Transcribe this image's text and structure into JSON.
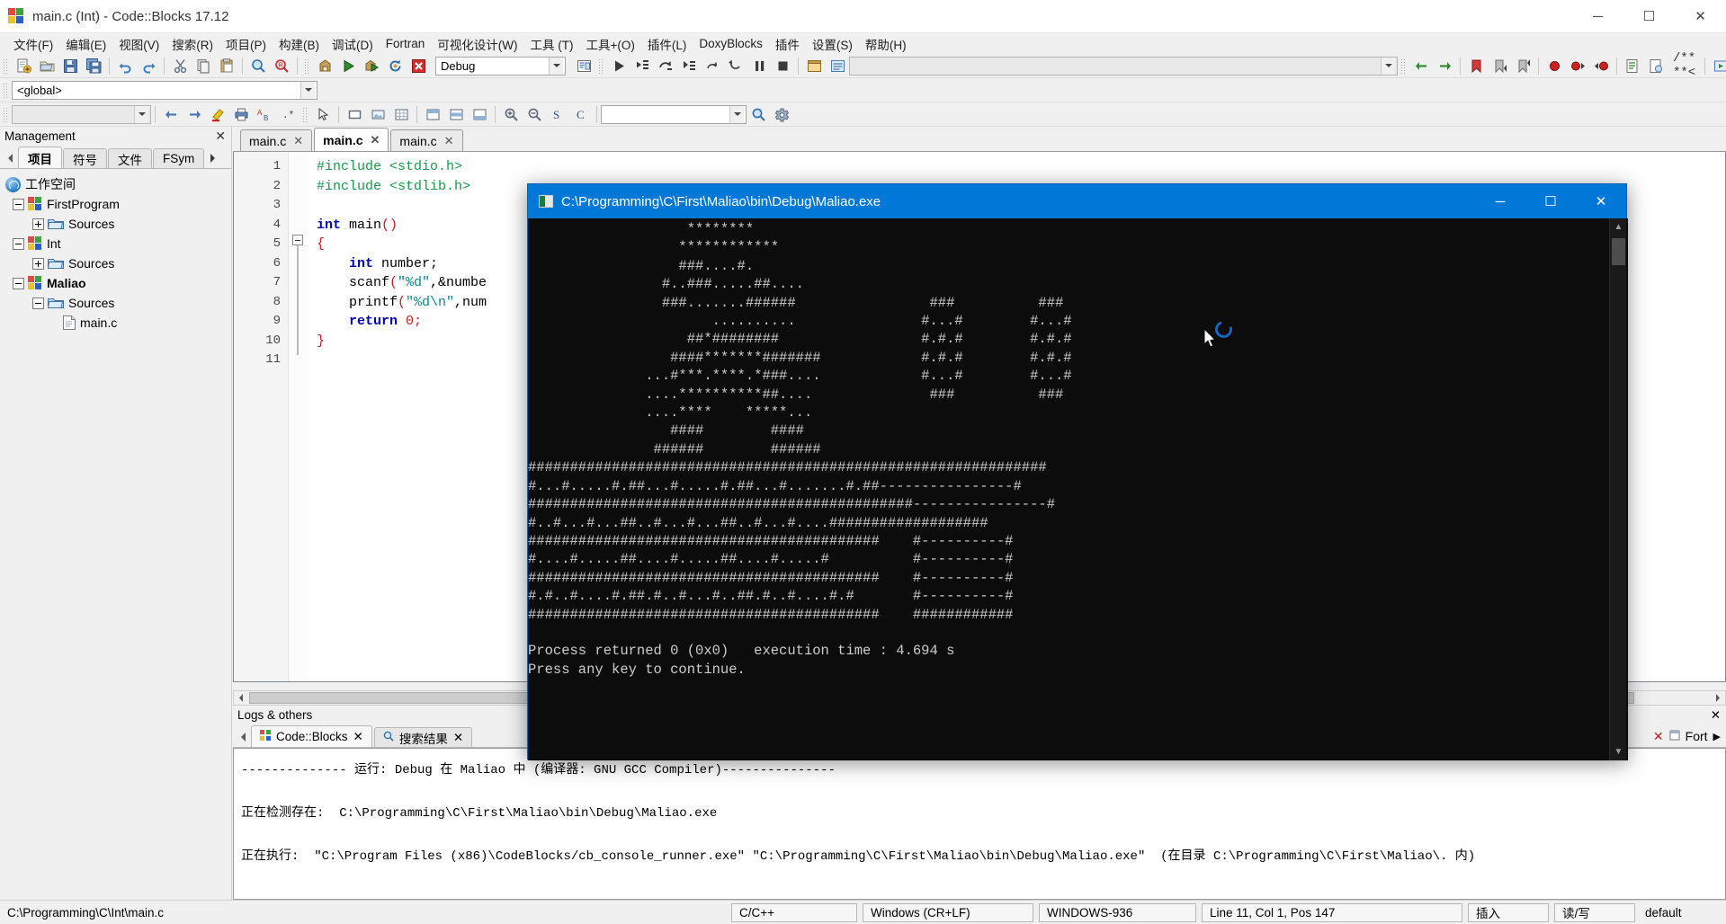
{
  "window": {
    "title": "main.c (Int) - Code::Blocks 17.12",
    "minimize": "─",
    "maximize": "☐",
    "close": "✕"
  },
  "menu": {
    "items": [
      {
        "label": "文件(F)"
      },
      {
        "label": "编辑(E)"
      },
      {
        "label": "视图(V)"
      },
      {
        "label": "搜索(R)"
      },
      {
        "label": "项目(P)"
      },
      {
        "label": "构建(B)"
      },
      {
        "label": "调试(D)"
      },
      {
        "label": "Fortran"
      },
      {
        "label": "可视化设计(W)"
      },
      {
        "label": "工具 (T)"
      },
      {
        "label": "工具+(O)"
      },
      {
        "label": "插件(L)"
      },
      {
        "label": "DoxyBlocks"
      },
      {
        "label": "插件"
      },
      {
        "label": "设置(S)"
      },
      {
        "label": "帮助(H)"
      }
    ]
  },
  "toolbar": {
    "build_target_value": "Debug",
    "scope_value": "<global>",
    "symbol_value": "",
    "search_value": "",
    "doxy_label": "/** **<",
    "icons_row1": [
      "new-file-icon",
      "open-file-icon",
      "save-icon",
      "save-all-icon",
      "undo-icon",
      "redo-icon",
      "cut-icon",
      "copy-icon",
      "paste-icon",
      "find-icon",
      "replace-icon",
      "build-icon",
      "run-icon",
      "build-and-run-icon",
      "rebuild-icon",
      "abort-icon",
      "build-target-select",
      "show-build-messages-icon",
      "debug-run-icon",
      "debug-step-into-icon",
      "debug-step-over-icon",
      "debug-step-out-icon",
      "debug-next-instruction-icon",
      "debug-step-instruction-icon",
      "debug-break-icon",
      "debug-stop-icon",
      "debugging-windows-icon",
      "various-info-icon"
    ],
    "icons_row3": [
      "back-icon",
      "forward-icon",
      "bookmark-toggle-icon",
      "bookmark-prev-icon",
      "bookmark-next-icon",
      "breakpoint-toggle-icon",
      "breakpoint-prev-icon",
      "breakpoint-next-icon",
      "comment-icon",
      "uncomment-icon",
      "doxy-comment-icon",
      "doxy-extract-icon",
      "doxy-config-icon",
      "doxy-run-icon",
      "align-left-icon",
      "center-icon",
      "align-right-icon"
    ],
    "icons_row2_left": [
      "scope-select"
    ],
    "icons_row2_right": [
      "prev-symbol-icon",
      "next-symbol-icon",
      "highlight-icon",
      "printer-icon",
      "translate-icon",
      "regex-icon",
      "select-pointer-icon",
      "rect-icon",
      "image-icon",
      "grid-icon",
      "layout-top-icon",
      "layout-mid-icon",
      "layout-bottom-icon",
      "zoom-in-icon",
      "zoom-out-icon",
      "s-icon",
      "c-icon",
      "search-field",
      "search-go-icon",
      "settings-icon"
    ]
  },
  "management": {
    "header": "Management",
    "close_icon": "✕",
    "tabs": [
      {
        "label": "项目",
        "active": true
      },
      {
        "label": "符号",
        "active": false
      },
      {
        "label": "文件",
        "active": false
      },
      {
        "label": "FSym",
        "active": false
      }
    ],
    "scroll_left_icon": "◀",
    "scroll_right_icon": "▶",
    "tree": [
      {
        "label": "工作空间",
        "depth": 0,
        "icon": "workspace-icon",
        "toggle": "none",
        "bold": false
      },
      {
        "label": "FirstProgram",
        "depth": 1,
        "icon": "project-icon",
        "toggle": "minus",
        "bold": false
      },
      {
        "label": "Sources",
        "depth": 2,
        "icon": "folder-icon",
        "toggle": "plus",
        "bold": false
      },
      {
        "label": "Int",
        "depth": 1,
        "icon": "project-icon",
        "toggle": "minus",
        "bold": false
      },
      {
        "label": "Sources",
        "depth": 2,
        "icon": "folder-icon",
        "toggle": "plus",
        "bold": false
      },
      {
        "label": "Maliao",
        "depth": 1,
        "icon": "project-icon",
        "toggle": "minus",
        "bold": true
      },
      {
        "label": "Sources",
        "depth": 2,
        "icon": "folder-icon",
        "toggle": "minus",
        "bold": false
      },
      {
        "label": "main.c",
        "depth": 3,
        "icon": "c-file-icon",
        "toggle": "none",
        "bold": false
      }
    ]
  },
  "editor": {
    "tabs": [
      {
        "label": "main.c",
        "active": false,
        "close": "✕"
      },
      {
        "label": "main.c",
        "active": true,
        "close": "✕"
      },
      {
        "label": "main.c",
        "active": false,
        "close": "✕"
      }
    ],
    "line_numbers": [
      "1",
      "2",
      "3",
      "4",
      "5",
      "6",
      "7",
      "8",
      "9",
      "10",
      "11"
    ],
    "lines": [
      [
        {
          "t": "#include <stdio.h>",
          "c": "k-pre"
        }
      ],
      [
        {
          "t": "#include <stdlib.h>",
          "c": "k-pre"
        }
      ],
      [
        {
          "t": "",
          "c": "k-id"
        }
      ],
      [
        {
          "t": "int",
          "c": "k-kw"
        },
        {
          "t": " main",
          "c": "k-id"
        },
        {
          "t": "()",
          "c": "k-pun"
        }
      ],
      [
        {
          "t": "{",
          "c": "k-pun"
        }
      ],
      [
        {
          "t": "    int",
          "c": "k-kw"
        },
        {
          "t": " number;",
          "c": "k-id"
        }
      ],
      [
        {
          "t": "    scanf",
          "c": "k-id"
        },
        {
          "t": "(",
          "c": "k-pun"
        },
        {
          "t": "\"%d\"",
          "c": "k-str"
        },
        {
          "t": ",&numbe",
          "c": "k-id"
        }
      ],
      [
        {
          "t": "    printf",
          "c": "k-id"
        },
        {
          "t": "(",
          "c": "k-pun"
        },
        {
          "t": "\"%d\\n\"",
          "c": "k-str"
        },
        {
          "t": ",num",
          "c": "k-id"
        }
      ],
      [
        {
          "t": "    return",
          "c": "k-kw"
        },
        {
          "t": " ",
          "c": "k-id"
        },
        {
          "t": "0",
          "c": "k-num"
        },
        {
          "t": ";",
          "c": "k-pun"
        }
      ],
      [
        {
          "t": "}",
          "c": "k-pun"
        }
      ],
      [
        {
          "t": "",
          "c": "k-id"
        }
      ]
    ]
  },
  "logs": {
    "header": "Logs & others",
    "close_icon": "✕",
    "scroll_left_icon": "◀",
    "scroll_right_icon": "▶",
    "tabs": [
      {
        "label": "Code::Blocks",
        "active": true,
        "icon": "codeblocks-icon",
        "close": "✕"
      },
      {
        "label": "搜索结果",
        "active": false,
        "icon": "search-icon",
        "close": "✕"
      }
    ],
    "right_close": "✕",
    "right_label": "Fort",
    "right_arrow": "▶",
    "body_lines": [
      "-------------- 运行: Debug 在 Maliao 中 (编译器: GNU GCC Compiler)---------------",
      "",
      "正在检测存在:  C:\\Programming\\C\\First\\Maliao\\bin\\Debug\\Maliao.exe",
      "",
      "正在执行:  \"C:\\Program Files (x86)\\CodeBlocks/cb_console_runner.exe\" \"C:\\Programming\\C\\First\\Maliao\\bin\\Debug\\Maliao.exe\"  (在目录 C:\\Programming\\C\\First\\Maliao\\. 内)"
    ]
  },
  "statusbar": {
    "file_path": "C:\\Programming\\C\\Int\\main.c",
    "language": "C/C++",
    "line_ending": "Windows (CR+LF)",
    "encoding": "WINDOWS-936",
    "caret": "Line 11, Col 1, Pos 147",
    "insert_mode": "插入",
    "readwrite": "读/写",
    "profile": "default"
  },
  "console": {
    "title": "C:\\Programming\\C\\First\\Maliao\\bin\\Debug\\Maliao.exe",
    "minimize": "─",
    "maximize": "☐",
    "close": "✕",
    "scroll_up": "▲",
    "scroll_down": "▼",
    "output": "                   ********\n                  ************\n                  ###....#.\n                #..###.....##....\n                ###.......######                ###          ###\n                                               #...#        #...#\n                      ..........                #.#.#        #.#.#\n                   ##*########                  #.#.#        #.#.#\n                 ####*******#######              #...#        #...#\n              ...#***.****.*###....               ###          ###\n              ....**********##....\n              ....****    *****...\n                 ####        ####\n               ######        ######\n##############################################################\n#...#.....#.##...#.....#.##...#.......#.##----------------#\n##############################################----------------#\n#..#...#...##..#...#...##..#...#....###################\n##########################################    #----------#\n#....#.....##....#.....##....#.....#          #----------#\n##########################################    #----------#\n#.#..#....#.##.#..#...#..##.#..#....#.#       #----------#\n##########################################    ############\n\nProcess returned 0 (0x0)   execution time : 4.694 s\nPress any key to continue.",
    "output_lines": [
      "                   ********",
      "                  ************",
      "                  ###....#.",
      "                #..###.....##....",
      "                ###.......######                ###          ###",
      "                      ..........               #...#        #...#",
      "                   ##*########                 #.#.#        #.#.#",
      "                 ####*******#######            #.#.#        #.#.#",
      "              ...#***.****.*###....            #...#        #...#",
      "              ....**********##....              ###          ###",
      "              ....****    *****...",
      "                 ####        ####",
      "               ######        ######",
      "##############################################################",
      "#...#.....#.##...#.....#.##...#.......#.##----------------#",
      "##############################################----------------#",
      "#..#...#...##..#...#...##..#...#....###################",
      "##########################################    #----------#",
      "#....#.....##....#.....##....#.....#          #----------#",
      "##########################################    #----------#",
      "#.#..#....#.##.#..#...#..##.#..#....#.#       #----------#",
      "##########################################    ############",
      "",
      "Process returned 0 (0x0)   execution time : 4.694 s",
      "Press any key to continue."
    ]
  },
  "colors": {
    "accent_blue": "#0078d7",
    "console_bg": "#0c0c0c",
    "console_fg": "#cccccc",
    "chrome": "#f0f0f0"
  }
}
